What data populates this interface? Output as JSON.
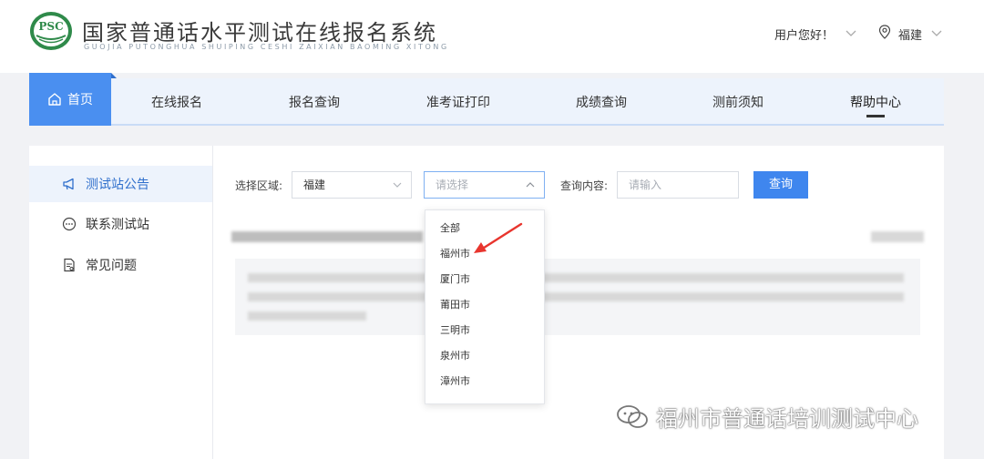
{
  "header": {
    "logo_text": "PSC",
    "title": "国家普通话水平测试在线报名系统",
    "subtitle": "GUOJIA PUTONGHUA SHUIPING CESHI ZAIXIAN BAOMING XITONG",
    "user_greeting": "用户您好！",
    "region": "福建"
  },
  "nav": {
    "items": [
      {
        "label": "首页"
      },
      {
        "label": "在线报名"
      },
      {
        "label": "报名查询"
      },
      {
        "label": "准考证打印"
      },
      {
        "label": "成绩查询"
      },
      {
        "label": "测前须知"
      },
      {
        "label": "帮助中心"
      }
    ],
    "active": "帮助中心",
    "highlighted": "首页"
  },
  "sidebar": {
    "items": [
      {
        "label": "测试站公告",
        "icon": "megaphone-icon",
        "active": true
      },
      {
        "label": "联系测试站",
        "icon": "chat-icon",
        "active": false
      },
      {
        "label": "常见问题",
        "icon": "document-icon",
        "active": false
      }
    ]
  },
  "filters": {
    "region_label": "选择区域:",
    "region_value": "福建",
    "city_placeholder": "请选择",
    "query_label": "查询内容:",
    "query_placeholder": "请输入",
    "search_button": "查询"
  },
  "dropdown": {
    "options": [
      "全部",
      "福州市",
      "厦门市",
      "莆田市",
      "三明市",
      "泉州市",
      "漳州市"
    ]
  },
  "watermark": {
    "text": "福州市普通话培训测试中心"
  },
  "colors": {
    "primary": "#3f86ee",
    "nav_bg": "#edf3fc",
    "annotation_arrow": "#e8352e"
  }
}
